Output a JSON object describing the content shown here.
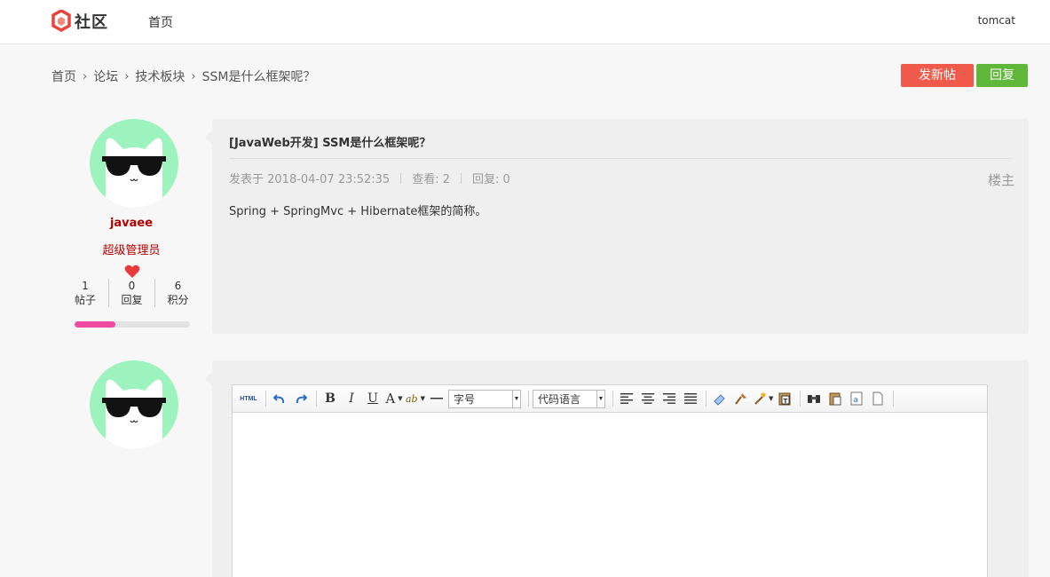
{
  "header": {
    "logo_text": "社区",
    "nav_home": "首页",
    "user": "tomcat"
  },
  "breadcrumb": {
    "items": [
      "首页",
      "论坛",
      "技术板块",
      "SSM是什么框架呢？"
    ],
    "separator": "›"
  },
  "actions": {
    "new_post": "发新帖",
    "reply": "回复"
  },
  "author": {
    "name": "javaee",
    "role": "超级管理员",
    "stats": [
      {
        "value": "1",
        "label": "帖子"
      },
      {
        "value": "0",
        "label": "回复"
      },
      {
        "value": "6",
        "label": "积分"
      }
    ],
    "level_progress": 0.35
  },
  "post": {
    "title": "[JavaWeb开发] SSM是什么框架呢？",
    "published": "发表于 2018-04-07 23:52:35",
    "views": "查看: 2",
    "replies": "回复: 0",
    "floor": "楼主",
    "body": "Spring + SpringMvc + Hibernate框架的简称。"
  },
  "editor": {
    "html_button": "HTML",
    "bold": "B",
    "italic": "I",
    "underline": "U",
    "font_color": "A",
    "highlight": "ab",
    "font_size_select": "字号",
    "code_lang_select": "代码语言"
  },
  "colors": {
    "new_post_btn": "#f05a4a",
    "reply_btn": "#5fb83a",
    "author_name": "#b20000",
    "avatar_bg": "#9cf3bd",
    "progress": "#ee4ba1"
  }
}
